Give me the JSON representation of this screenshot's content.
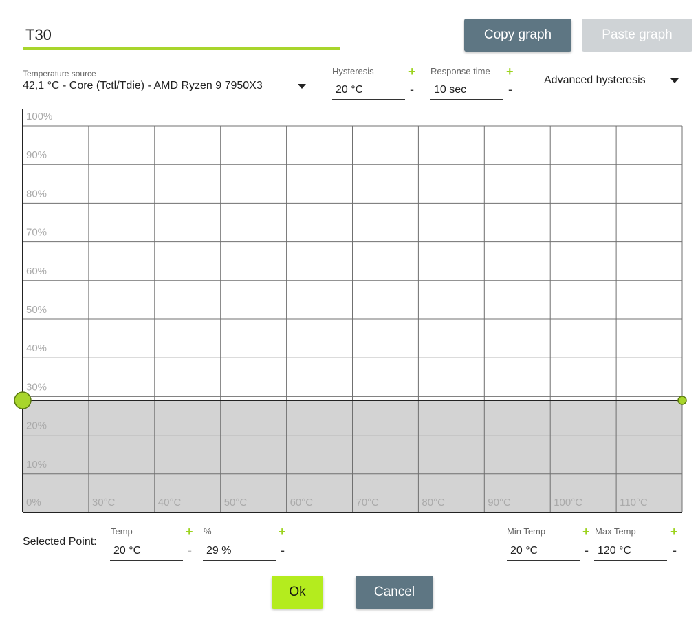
{
  "curve": {
    "name": "T30",
    "copy_label": "Copy graph",
    "paste_label": "Paste graph"
  },
  "source": {
    "caption": "Temperature source",
    "value": "42,1 °C - Core (Tctl/Tdie) - AMD Ryzen 9 7950X3"
  },
  "hysteresis": {
    "caption": "Hysteresis",
    "value": "20 °C",
    "plus": "+",
    "minus": "-"
  },
  "response": {
    "caption": "Response time",
    "value": "10 sec",
    "plus": "+",
    "minus": "-"
  },
  "advanced": {
    "label": "Advanced hysteresis"
  },
  "graph": {
    "y_labels": [
      "100%",
      "90%",
      "80%",
      "70%",
      "60%",
      "50%",
      "40%",
      "30%",
      "20%",
      "10%"
    ],
    "x_labels": [
      "0%",
      "30°C",
      "40°C",
      "50°C",
      "60°C",
      "70°C",
      "80°C",
      "90°C",
      "100°C",
      "110°C"
    ],
    "level_percent": 29,
    "colors": {
      "accent": "#a8d52c",
      "fill": "#d3d3d3",
      "grid": "#707070",
      "axis": "#222222"
    }
  },
  "selected": {
    "label": "Selected Point:",
    "temp_caption": "Temp",
    "temp_value": "20 °C",
    "pct_caption": "%",
    "pct_value": "29 %",
    "plus": "+",
    "minus": "-"
  },
  "range": {
    "min_caption": "Min Temp",
    "min_value": "20 °C",
    "max_caption": "Max Temp",
    "max_value": "120 °C",
    "plus": "+",
    "minus": "-"
  },
  "footer": {
    "ok_label": "Ok",
    "cancel_label": "Cancel"
  }
}
